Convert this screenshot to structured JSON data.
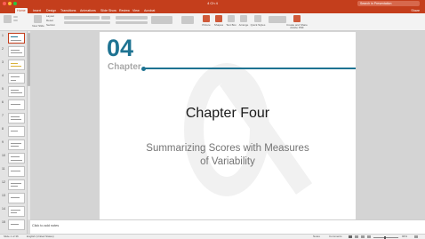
{
  "window": {
    "title": "4 Ch 4",
    "search_placeholder": "Search in Presentation",
    "colors": {
      "accent": "#c43e1c",
      "teal": "#1e7392"
    }
  },
  "ribbon": {
    "tabs": [
      {
        "label": "Home",
        "active": true
      },
      {
        "label": "Insert",
        "active": false
      },
      {
        "label": "Design",
        "active": false
      },
      {
        "label": "Transitions",
        "active": false
      },
      {
        "label": "Animations",
        "active": false
      },
      {
        "label": "Slide Show",
        "active": false
      },
      {
        "label": "Review",
        "active": false
      },
      {
        "label": "View",
        "active": false
      },
      {
        "label": "Acrobat",
        "active": false
      }
    ],
    "share_label": "Share",
    "small_labels": {
      "layout": "Layout",
      "reset": "Reset",
      "section": "Section",
      "new_slide": "New Slide",
      "picture": "Picture",
      "shapes": "Shapes",
      "text_box": "Text Box",
      "arrange": "Arrange",
      "quick_styles": "Quick Styles",
      "create_share_pdf": "Create and Share Adobe PDF"
    }
  },
  "thumbnails": [
    {
      "num": "1",
      "selected": true
    },
    {
      "num": "2",
      "selected": false
    },
    {
      "num": "3",
      "selected": false
    },
    {
      "num": "4",
      "selected": false
    },
    {
      "num": "5",
      "selected": false
    },
    {
      "num": "6",
      "selected": false
    },
    {
      "num": "7",
      "selected": false
    },
    {
      "num": "8",
      "selected": false
    },
    {
      "num": "9",
      "selected": false
    },
    {
      "num": "10",
      "selected": false
    },
    {
      "num": "11",
      "selected": false
    },
    {
      "num": "12",
      "selected": false
    },
    {
      "num": "13",
      "selected": false
    },
    {
      "num": "14",
      "selected": false
    },
    {
      "num": "15",
      "selected": false
    }
  ],
  "slide": {
    "chapter_number": "04",
    "chapter_word": "Chapter",
    "title": "Chapter Four",
    "subtitle_line1": "Summarizing Scores with Measures",
    "subtitle_line2": "of Variability"
  },
  "notes": {
    "placeholder": "Click to add notes"
  },
  "status": {
    "slide_counter": "Slide 1 of 36",
    "language": "English (United States)",
    "notes_label": "Notes",
    "comments_label": "Comments",
    "zoom": "96%"
  }
}
